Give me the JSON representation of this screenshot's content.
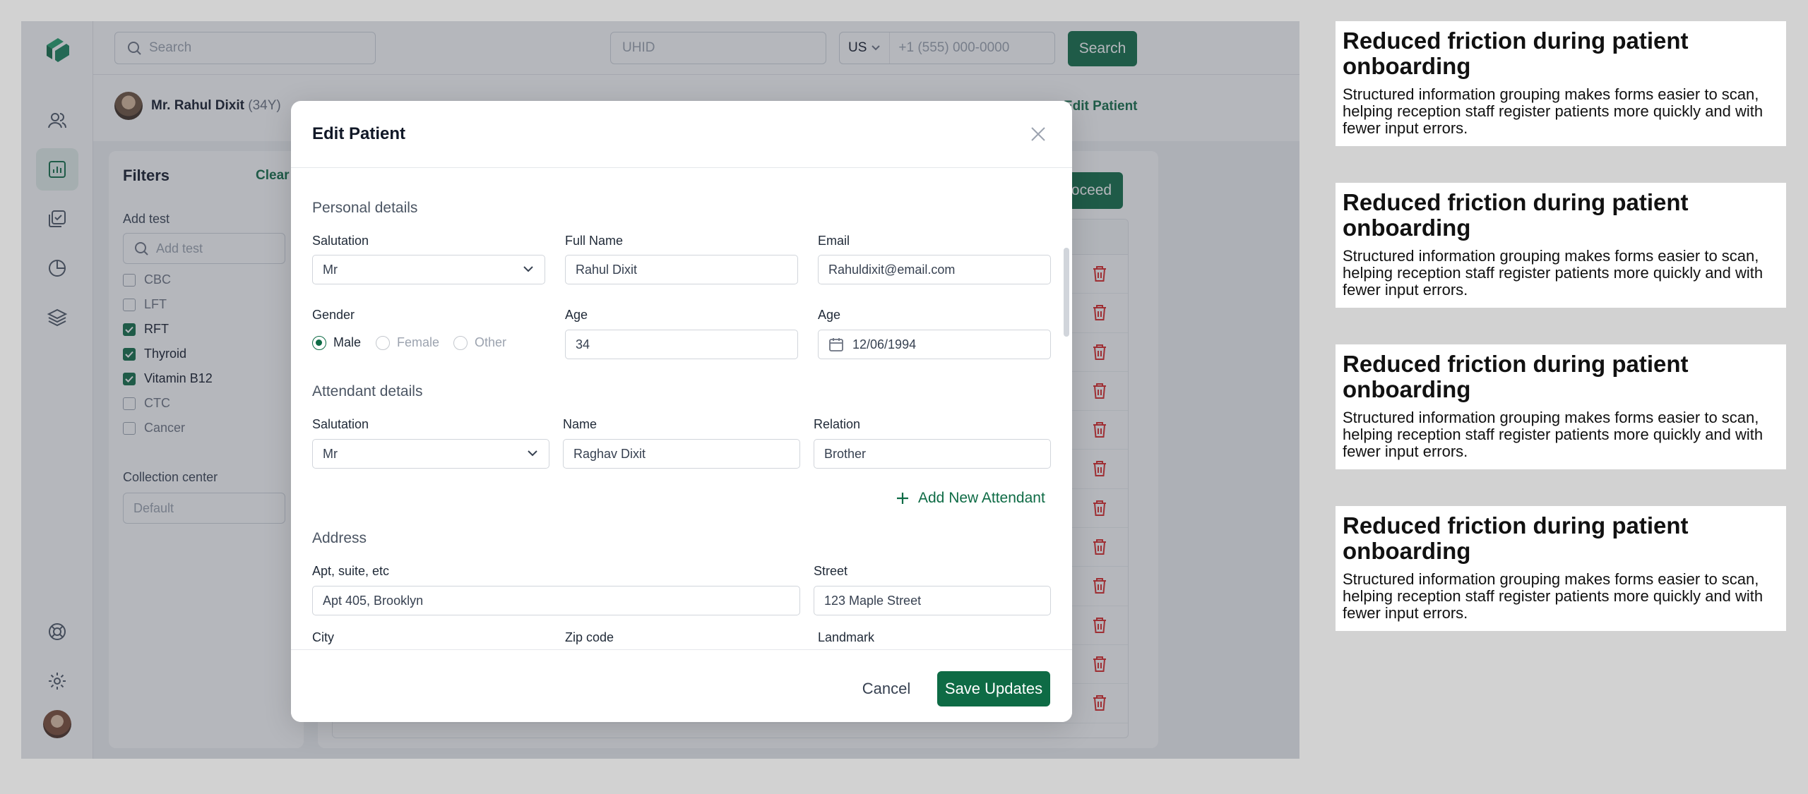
{
  "topbar": {
    "search_placeholder": "Search",
    "uhid_placeholder": "UHID",
    "country_code": "US",
    "phone_placeholder": "+1 (555) 000-0000",
    "search_button": "Search"
  },
  "patient": {
    "name": "Mr. Rahul Dixit",
    "age": "(34Y)",
    "edit_link": "Edit Patient"
  },
  "filters": {
    "title": "Filters",
    "clear": "Clear",
    "add_test_label": "Add test",
    "add_test_placeholder": "Add test",
    "tests": [
      {
        "label": "CBC",
        "checked": false
      },
      {
        "label": "LFT",
        "checked": false
      },
      {
        "label": "RFT",
        "checked": true
      },
      {
        "label": "Thyroid",
        "checked": true
      },
      {
        "label": "Vitamin B12",
        "checked": true
      },
      {
        "label": "CTC",
        "checked": false
      },
      {
        "label": "Cancer",
        "checked": false
      }
    ],
    "collection_label": "Collection center",
    "collection_value": "Default"
  },
  "results": {
    "proceed_button": "Proceed"
  },
  "modal": {
    "title": "Edit Patient",
    "personal": {
      "heading": "Personal details",
      "salutation_label": "Salutation",
      "salutation_value": "Mr",
      "fullname_label": "Full Name",
      "fullname_value": "Rahul Dixit",
      "email_label": "Email",
      "email_value": "Rahuldixit@email.com",
      "gender_label": "Gender",
      "gender_options": [
        "Male",
        "Female",
        "Other"
      ],
      "gender_selected": "Male",
      "age_label": "Age",
      "age_value": "34",
      "dob_label": "Age",
      "dob_value": "12/06/1994"
    },
    "attendant": {
      "heading": "Attendant details",
      "salutation_label": "Salutation",
      "salutation_value": "Mr",
      "name_label": "Name",
      "name_value": "Raghav Dixit",
      "relation_label": "Relation",
      "relation_value": "Brother",
      "add_new": "Add New Attendant"
    },
    "address": {
      "heading": "Address",
      "apt_label": "Apt, suite, etc",
      "apt_value": "Apt 405, Brooklyn",
      "street_label": "Street",
      "street_value": "123 Maple Street",
      "city_label": "City",
      "zip_label": "Zip code",
      "landmark_label": "Landmark"
    },
    "cancel_button": "Cancel",
    "save_button": "Save Updates"
  },
  "cards": [
    {
      "title": "Reduced friction during patient onboarding",
      "body": "Structured information grouping makes forms easier to scan, helping reception staff register patients more quickly and with fewer input errors."
    },
    {
      "title": "Reduced friction during patient onboarding",
      "body": "Structured information grouping makes forms easier to scan, helping reception staff register patients more quickly and with fewer input errors."
    },
    {
      "title": "Reduced friction during patient onboarding",
      "body": "Structured information grouping makes forms easier to scan, helping reception staff register patients more quickly and with fewer input errors."
    },
    {
      "title": "Reduced friction during patient onboarding",
      "body": "Structured information grouping makes forms easier to scan, helping reception staff register patients more quickly and with fewer input errors."
    }
  ],
  "colors": {
    "brand": "#0e6b45",
    "delete": "#dc2626",
    "backdrop": "#d2d2d2"
  }
}
